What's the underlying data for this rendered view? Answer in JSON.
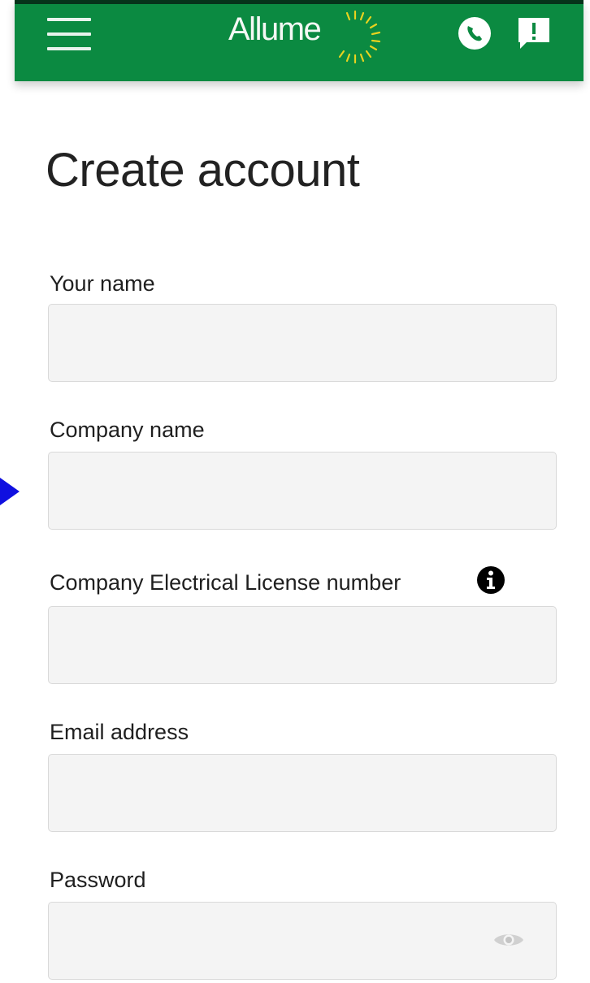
{
  "header": {
    "logo_text": "Allume",
    "menu_icon": "hamburger-menu-icon",
    "phone_icon": "phone-icon",
    "feedback_icon": "feedback-icon",
    "brand_color": "#0b8a41"
  },
  "page": {
    "title": "Create account"
  },
  "form": {
    "fields": [
      {
        "label": "Your name",
        "value": ""
      },
      {
        "label": "Company name",
        "value": ""
      },
      {
        "label": "Company Electrical License number",
        "value": "",
        "info_icon": "info-icon"
      },
      {
        "label": "Email address",
        "value": ""
      },
      {
        "label": "Password",
        "value": "",
        "toggle_icon": "eye-icon"
      }
    ]
  },
  "overlay": {
    "pointer_icon": "pointer-arrow-icon",
    "pointer_color": "#1010e0"
  }
}
